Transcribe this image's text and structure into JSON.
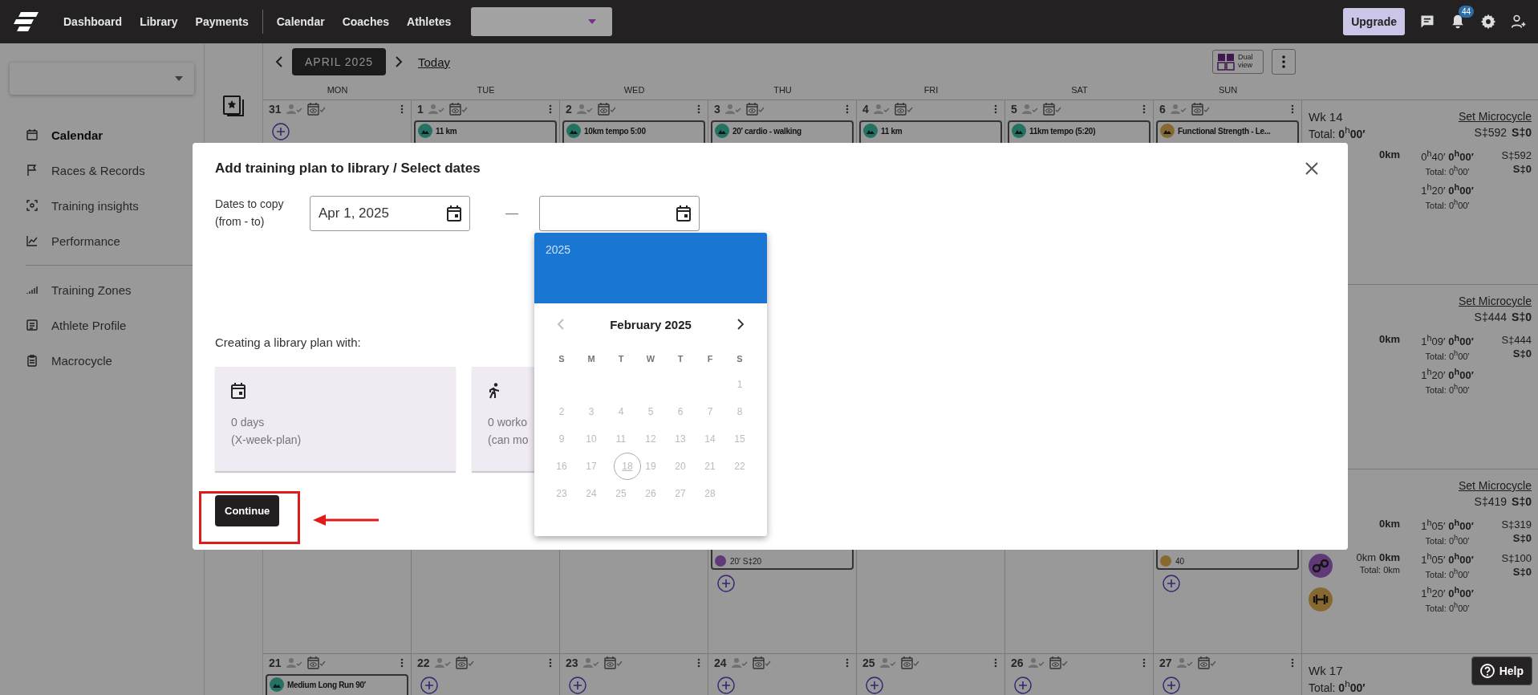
{
  "nav": {
    "link_groups": [
      [
        {
          "label": "Dashboard"
        },
        {
          "label": "Library"
        },
        {
          "label": "Payments"
        }
      ],
      [
        {
          "label": "Calendar"
        },
        {
          "label": "Coaches"
        },
        {
          "label": "Athletes"
        }
      ]
    ],
    "upgrade": "Upgrade",
    "notifications": "44"
  },
  "sidebar": {
    "groups": [
      [
        {
          "label": "Calendar",
          "selected": true
        },
        {
          "label": "Races & Records",
          "selected": false
        },
        {
          "label": "Training insights",
          "selected": false
        },
        {
          "label": "Performance",
          "selected": false
        }
      ],
      [
        {
          "label": "Training Zones",
          "selected": false
        },
        {
          "label": "Athlete Profile",
          "selected": false
        },
        {
          "label": "Macrocycle",
          "selected": false
        }
      ]
    ]
  },
  "calendar": {
    "month": "APRIL 2025",
    "today": "Today",
    "dual_view": "Dual view",
    "weekdays": [
      "MON",
      "TUE",
      "WED",
      "THU",
      "FRI",
      "SAT",
      "SUN"
    ],
    "weeks": [
      {
        "days": [
          {
            "number": "31",
            "add": true
          },
          {
            "number": "1",
            "cards": [
              {
                "title": "11 km",
                "kind": "run"
              }
            ]
          },
          {
            "number": "2",
            "cards": [
              {
                "title": "10km tempo 5:00",
                "kind": "run"
              }
            ]
          },
          {
            "number": "3",
            "cards": [
              {
                "title": "20′ cardio - walking",
                "kind": "run"
              }
            ]
          },
          {
            "number": "4",
            "cards": [
              {
                "title": "11 km",
                "kind": "run"
              }
            ]
          },
          {
            "number": "5",
            "cards": [
              {
                "title": "11km tempo (5:20)",
                "kind": "run"
              }
            ]
          },
          {
            "number": "6",
            "cards": [
              {
                "title": "Functional Strength - Le...",
                "kind": "strength"
              }
            ]
          }
        ],
        "summary": {
          "week": "Wk 14",
          "link": "Set Microcycle",
          "total": "Total: **0**$^{h}$**00′**",
          "stress": "S‡592",
          "stress_done": "S‡0",
          "rows": [
            {
              "dist_done": "0km",
              "time": "0$^{h}$40′",
              "time_done": "0$^{h}$00′",
              "time_total": "Total: 0$^{h}$00′",
              "stress": "S‡592",
              "stress_done": "S‡0"
            },
            {
              "time": "1$^{h}$20′",
              "time_done": "0$^{h}$00′",
              "time_total": "Total: 0$^{h}$00′"
            }
          ]
        }
      },
      {
        "summary": {
          "link": "Set Microcycle",
          "stress": "S‡444",
          "stress_done": "S‡0",
          "rows": [
            {
              "dist_done": "0km",
              "time": "1$^{h}$09′",
              "time_done": "0$^{h}$00′",
              "time_total": "Total: 0$^{h}$00′",
              "stress": "S‡444",
              "stress_done": "S‡0"
            },
            {
              "time": "1$^{h}$20′",
              "time_done": "0$^{h}$00′",
              "time_total": "Total: 0$^{h}$00′"
            }
          ]
        }
      },
      {
        "days": [
          {
            "kind": "covered"
          },
          {
            "kind": "covered"
          },
          {
            "kind": "covered"
          },
          {
            "kind": "day",
            "add": true,
            "cards": [
              {
                "kind": "bike",
                "footer": "20′ S‡20"
              }
            ]
          },
          {
            "kind": "covered"
          },
          {
            "kind": "covered"
          },
          {
            "kind": "day",
            "add": true,
            "cards": [
              {
                "kind": "strength",
                "footer": "40"
              }
            ]
          }
        ],
        "summary": {
          "link": "Set Microcycle",
          "stress": "S‡419",
          "stress_done": "S‡0",
          "rows": [
            {
              "dist_done": "0km",
              "time": "1$^{h}$05′",
              "time_done": "0$^{h}$00′",
              "time_total": "Total: 0$^{h}$00′",
              "stress": "S‡319",
              "stress_done": "S‡0"
            },
            {
              "kind": "bike",
              "dist": "0km",
              "dist_done": "0km",
              "dist_total": "Total: 0km",
              "time": "1$^{h}$05′",
              "time_done": "0$^{h}$00′",
              "time_total": "Total: 0$^{h}$00′",
              "stress": "S‡100",
              "stress_done": "S‡0"
            },
            {
              "kind": "strength",
              "time": "1$^{h}$20′",
              "time_done": "0$^{h}$00′",
              "time_total": "Total: 0$^{h}$00′"
            }
          ]
        }
      },
      {
        "days": [
          {
            "number": "21",
            "cards": [
              {
                "title": "Medium Long Run 90′",
                "kind": "run"
              }
            ]
          },
          {
            "number": "22",
            "add": true
          },
          {
            "number": "23",
            "add": true
          },
          {
            "number": "24",
            "add": true
          },
          {
            "number": "25",
            "add": true
          },
          {
            "number": "26",
            "add": true
          },
          {
            "number": "27",
            "add": true
          }
        ],
        "summary": {
          "week": "Wk 17",
          "total": "Total: **0**$^{h}$**00′**"
        }
      }
    ]
  },
  "modal": {
    "title": "Add training plan to library / Select dates",
    "dates_label": "Dates to copy (from - to)",
    "from_value": "Apr 1, 2025",
    "separator": "—",
    "summary_label": "Creating a library plan with:",
    "options": [
      {
        "line1": "0 days",
        "line2": "(X-week-plan)"
      },
      {
        "line1": "0 worko",
        "line2": "(can mo"
      }
    ],
    "continue": "Continue"
  },
  "datepicker": {
    "year": "2025",
    "month": "February 2025",
    "prev_disabled": true,
    "weekdays": [
      "S",
      "M",
      "T",
      "W",
      "T",
      "F",
      "S"
    ],
    "weeks": [
      [
        {
          "kind": "blank"
        },
        {
          "kind": "blank"
        },
        {
          "kind": "blank"
        },
        {
          "kind": "blank"
        },
        {
          "kind": "blank"
        },
        {
          "kind": "blank"
        },
        {
          "kind": "day",
          "day": "1",
          "disabled": true,
          "today": false
        }
      ],
      [
        {
          "kind": "day",
          "day": "2",
          "disabled": true,
          "today": false
        },
        {
          "kind": "day",
          "day": "3",
          "disabled": true,
          "today": false
        },
        {
          "kind": "day",
          "day": "4",
          "disabled": true,
          "today": false
        },
        {
          "kind": "day",
          "day": "5",
          "disabled": true,
          "today": false
        },
        {
          "kind": "day",
          "day": "6",
          "disabled": true,
          "today": false
        },
        {
          "kind": "day",
          "day": "7",
          "disabled": true,
          "today": false
        },
        {
          "kind": "day",
          "day": "8",
          "disabled": true,
          "today": false
        }
      ],
      [
        {
          "kind": "day",
          "day": "9",
          "disabled": true,
          "today": false
        },
        {
          "kind": "day",
          "day": "10",
          "disabled": true,
          "today": false
        },
        {
          "kind": "day",
          "day": "11",
          "disabled": true,
          "today": false
        },
        {
          "kind": "day",
          "day": "12",
          "disabled": true,
          "today": false
        },
        {
          "kind": "day",
          "day": "13",
          "disabled": true,
          "today": false
        },
        {
          "kind": "day",
          "day": "14",
          "disabled": true,
          "today": false
        },
        {
          "kind": "day",
          "day": "15",
          "disabled": true,
          "today": false
        }
      ],
      [
        {
          "kind": "day",
          "day": "16",
          "disabled": true,
          "today": false
        },
        {
          "kind": "day",
          "day": "17",
          "disabled": true,
          "today": false
        },
        {
          "kind": "day",
          "day": "18",
          "disabled": true,
          "today": true
        },
        {
          "kind": "day",
          "day": "19",
          "disabled": true,
          "today": false
        },
        {
          "kind": "day",
          "day": "20",
          "disabled": true,
          "today": false
        },
        {
          "kind": "day",
          "day": "21",
          "disabled": true,
          "today": false
        },
        {
          "kind": "day",
          "day": "22",
          "disabled": true,
          "today": false
        }
      ],
      [
        {
          "kind": "day",
          "day": "23",
          "disabled": true,
          "today": false
        },
        {
          "kind": "day",
          "day": "24",
          "disabled": true,
          "today": false
        },
        {
          "kind": "day",
          "day": "25",
          "disabled": true,
          "today": false
        },
        {
          "kind": "day",
          "day": "26",
          "disabled": true,
          "today": false
        },
        {
          "kind": "day",
          "day": "27",
          "disabled": true,
          "today": false
        },
        {
          "kind": "day",
          "day": "28",
          "disabled": true,
          "today": false
        },
        {
          "kind": "blank"
        }
      ]
    ]
  },
  "help": "Help"
}
